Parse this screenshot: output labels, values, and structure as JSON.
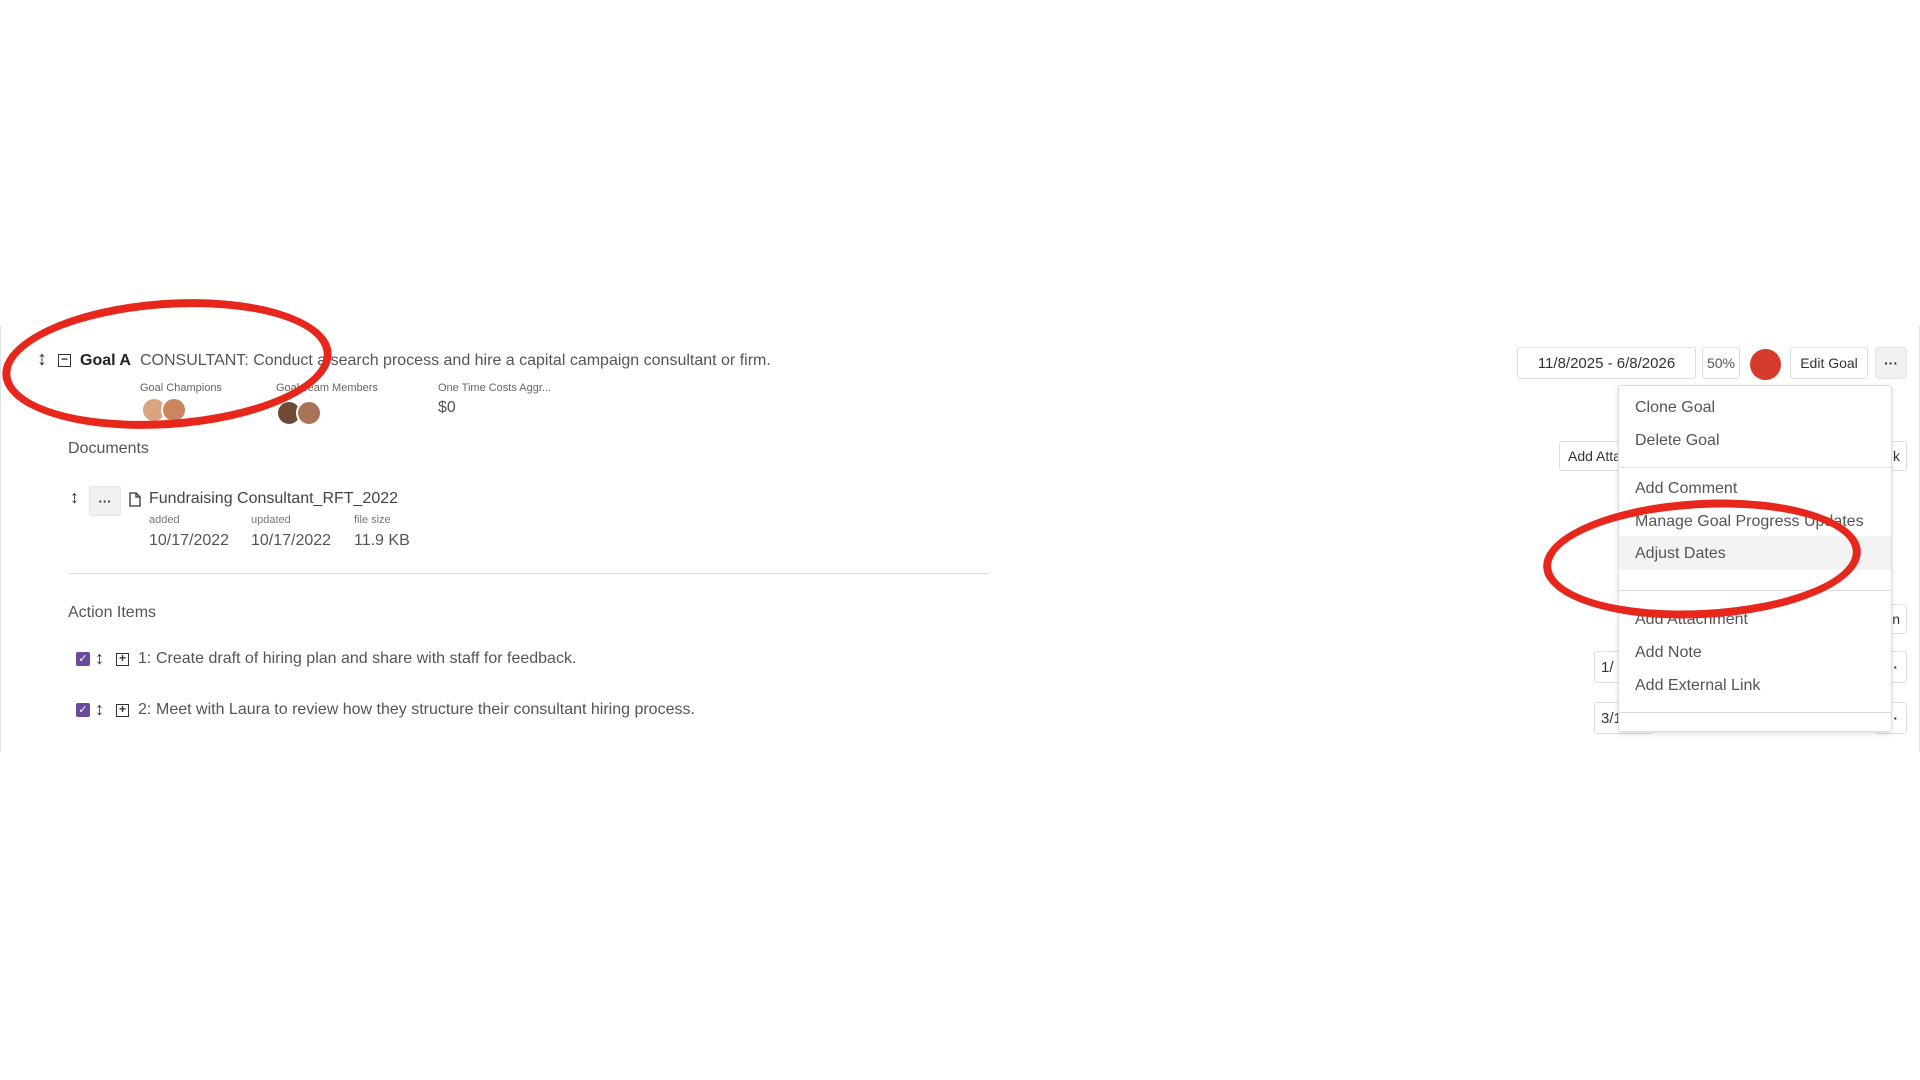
{
  "goal": {
    "label": "Goal A",
    "text": "CONSULTANT: Conduct a search process and hire a capital campaign consultant or firm.",
    "champions_label": "Goal Champions",
    "team_label": "Goal Team Members",
    "costs_label": "One Time Costs Aggr...",
    "costs_value": "$0",
    "date_range": "11/8/2025 - 6/8/2026",
    "progress": "50%",
    "status_color": "#d63a2b",
    "edit_label": "Edit Goal",
    "more_label": "···"
  },
  "documents": {
    "heading": "Documents",
    "items": [
      {
        "more_label": "···",
        "name": "Fundraising Consultant_RFT_2022",
        "added_label": "added",
        "added": "10/17/2022",
        "updated_label": "updated",
        "updated": "10/17/2022",
        "size_label": "file size",
        "size": "11.9 KB"
      }
    ],
    "add_attachment_label": "Add Atta",
    "right_fragment": "k"
  },
  "action_items": {
    "heading": "Action Items",
    "items": [
      {
        "num": "1:",
        "text": "Create draft of hiring plan and share with staff for feedback.",
        "date_frag": "1/"
      },
      {
        "num": "2:",
        "text": "Meet with Laura to review how they structure their consultant hiring process.",
        "date_frag": "3/1"
      }
    ],
    "right_fragment": "n"
  },
  "menu": {
    "items": [
      "Clone Goal",
      "Delete Goal",
      "Add Comment",
      "Manage Goal Progress Updates",
      "Adjust Dates",
      "Add Attachment",
      "Add Note",
      "Add External Link"
    ]
  },
  "annotation": {
    "color": "#e8271c"
  }
}
